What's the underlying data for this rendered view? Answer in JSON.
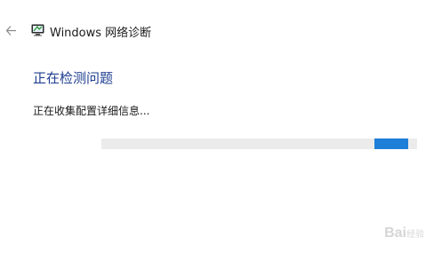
{
  "window": {
    "title": "Windows 网络诊断"
  },
  "icons": {
    "back": "back-arrow-icon",
    "app": "network-diagnostics-icon"
  },
  "main": {
    "heading": "正在检测问题",
    "status": "正在收集配置详细信息..."
  },
  "progress": {
    "mode": "indeterminate",
    "fill_color": "#1e7fd8",
    "track_color": "#ebebeb"
  },
  "colors": {
    "heading": "#1e3d8f",
    "text": "#1a1a1a",
    "background": "#ffffff"
  },
  "watermark": {
    "text": "Bai",
    "suffix": "经验"
  }
}
